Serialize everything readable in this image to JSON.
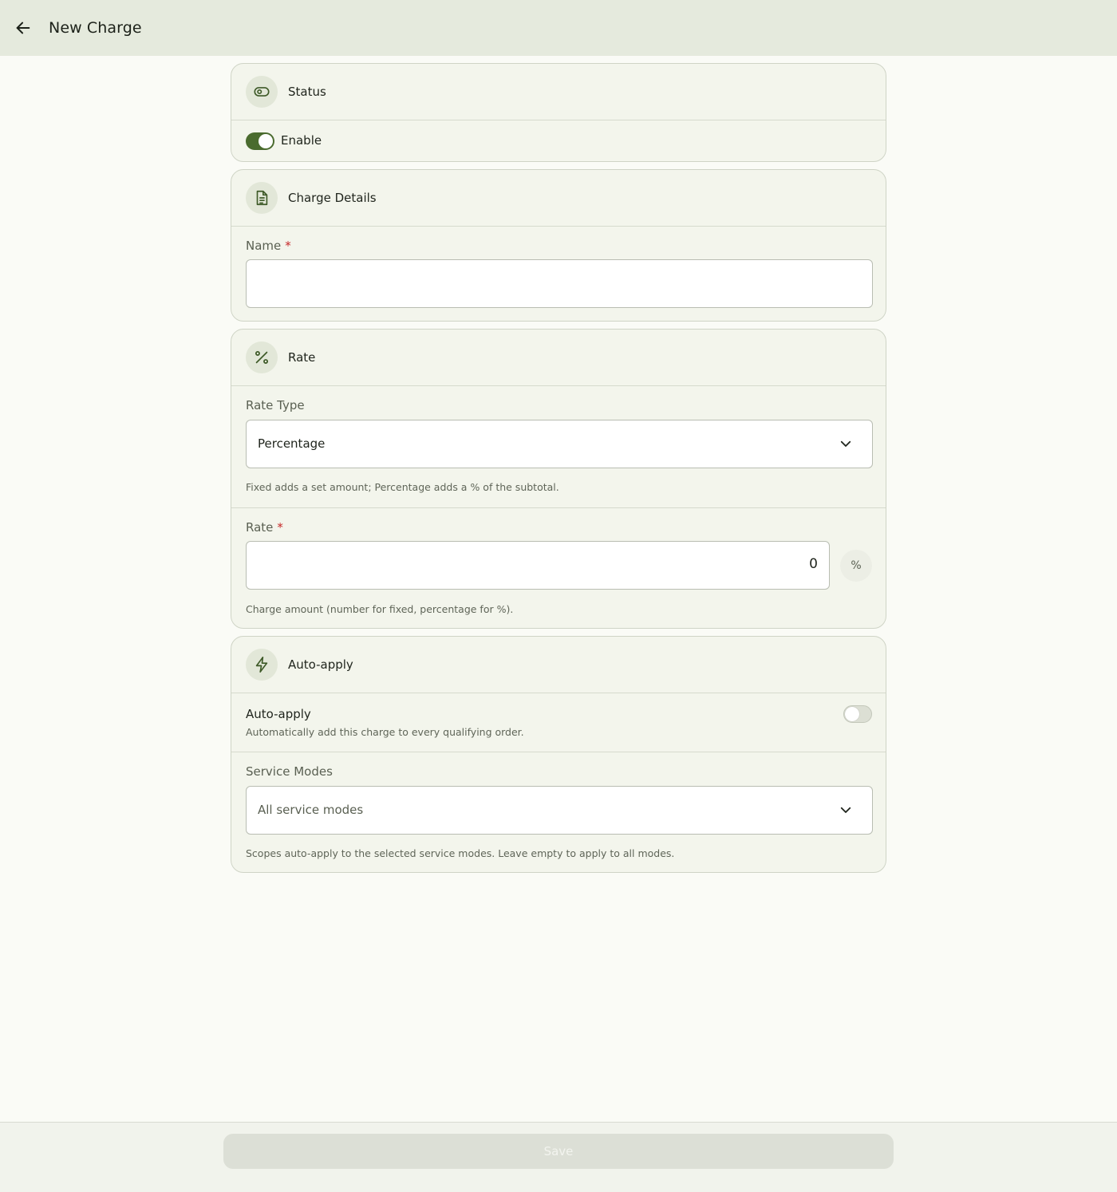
{
  "header": {
    "title": "New Charge",
    "back_icon": "arrow-left-icon"
  },
  "status_card": {
    "title": "Status",
    "icon": "eye-icon",
    "enable_label": "Enable",
    "enabled": true
  },
  "details_card": {
    "title": "Charge Details",
    "icon": "document-icon",
    "name_label": "Name",
    "required_mark": "*",
    "name_value": ""
  },
  "rate_card": {
    "title": "Rate",
    "icon": "percent-icon",
    "rate_type_label": "Rate Type",
    "rate_type_value": "Percentage",
    "rate_type_helper": "Fixed adds a set amount; Percentage adds a % of the subtotal.",
    "rate_label": "Rate",
    "required_mark": "*",
    "rate_value": "0",
    "rate_suffix": "%",
    "rate_helper": "Charge amount (number for fixed, percentage for %)."
  },
  "autoapply_card": {
    "title": "Auto-apply",
    "icon": "lightning-icon",
    "toggle_label": "Auto-apply",
    "toggle_desc": "Automatically add this charge to every qualifying order.",
    "enabled": false,
    "service_modes_label": "Service Modes",
    "service_modes_placeholder": "All service modes",
    "service_modes_helper": "Scopes auto-apply to the selected service modes. Leave empty to apply to all modes."
  },
  "footer": {
    "save_label": "Save"
  },
  "colors": {
    "accent": "#4a6b2e",
    "header_bg": "#e5eadd",
    "card_bg": "#f3f5ec",
    "required": "#c62828"
  }
}
